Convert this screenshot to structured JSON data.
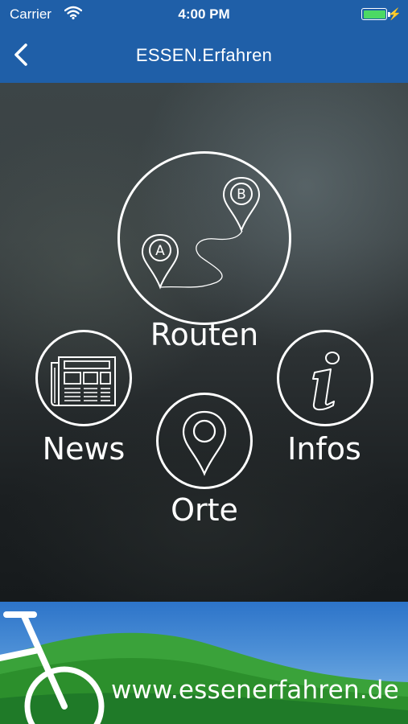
{
  "status_bar": {
    "carrier": "Carrier",
    "time": "4:00 PM",
    "wifi_icon": "wifi-icon",
    "battery_icon": "battery-charging-icon",
    "battery_color": "#4cd964"
  },
  "nav_bar": {
    "title": "ESSEN.Erfahren",
    "back_icon": "chevron-left-icon",
    "background": "#1f5fa8"
  },
  "menu": {
    "routen": {
      "label": "Routen",
      "icon": "route-map-icon",
      "pin_a": "A",
      "pin_b": "B"
    },
    "news": {
      "label": "News",
      "icon": "newspaper-icon"
    },
    "infos": {
      "label": "Infos",
      "icon": "info-icon"
    },
    "orte": {
      "label": "Orte",
      "icon": "location-pin-icon"
    }
  },
  "banner": {
    "url": "www.essenerfahren.de",
    "icon": "bicycle-icon"
  }
}
